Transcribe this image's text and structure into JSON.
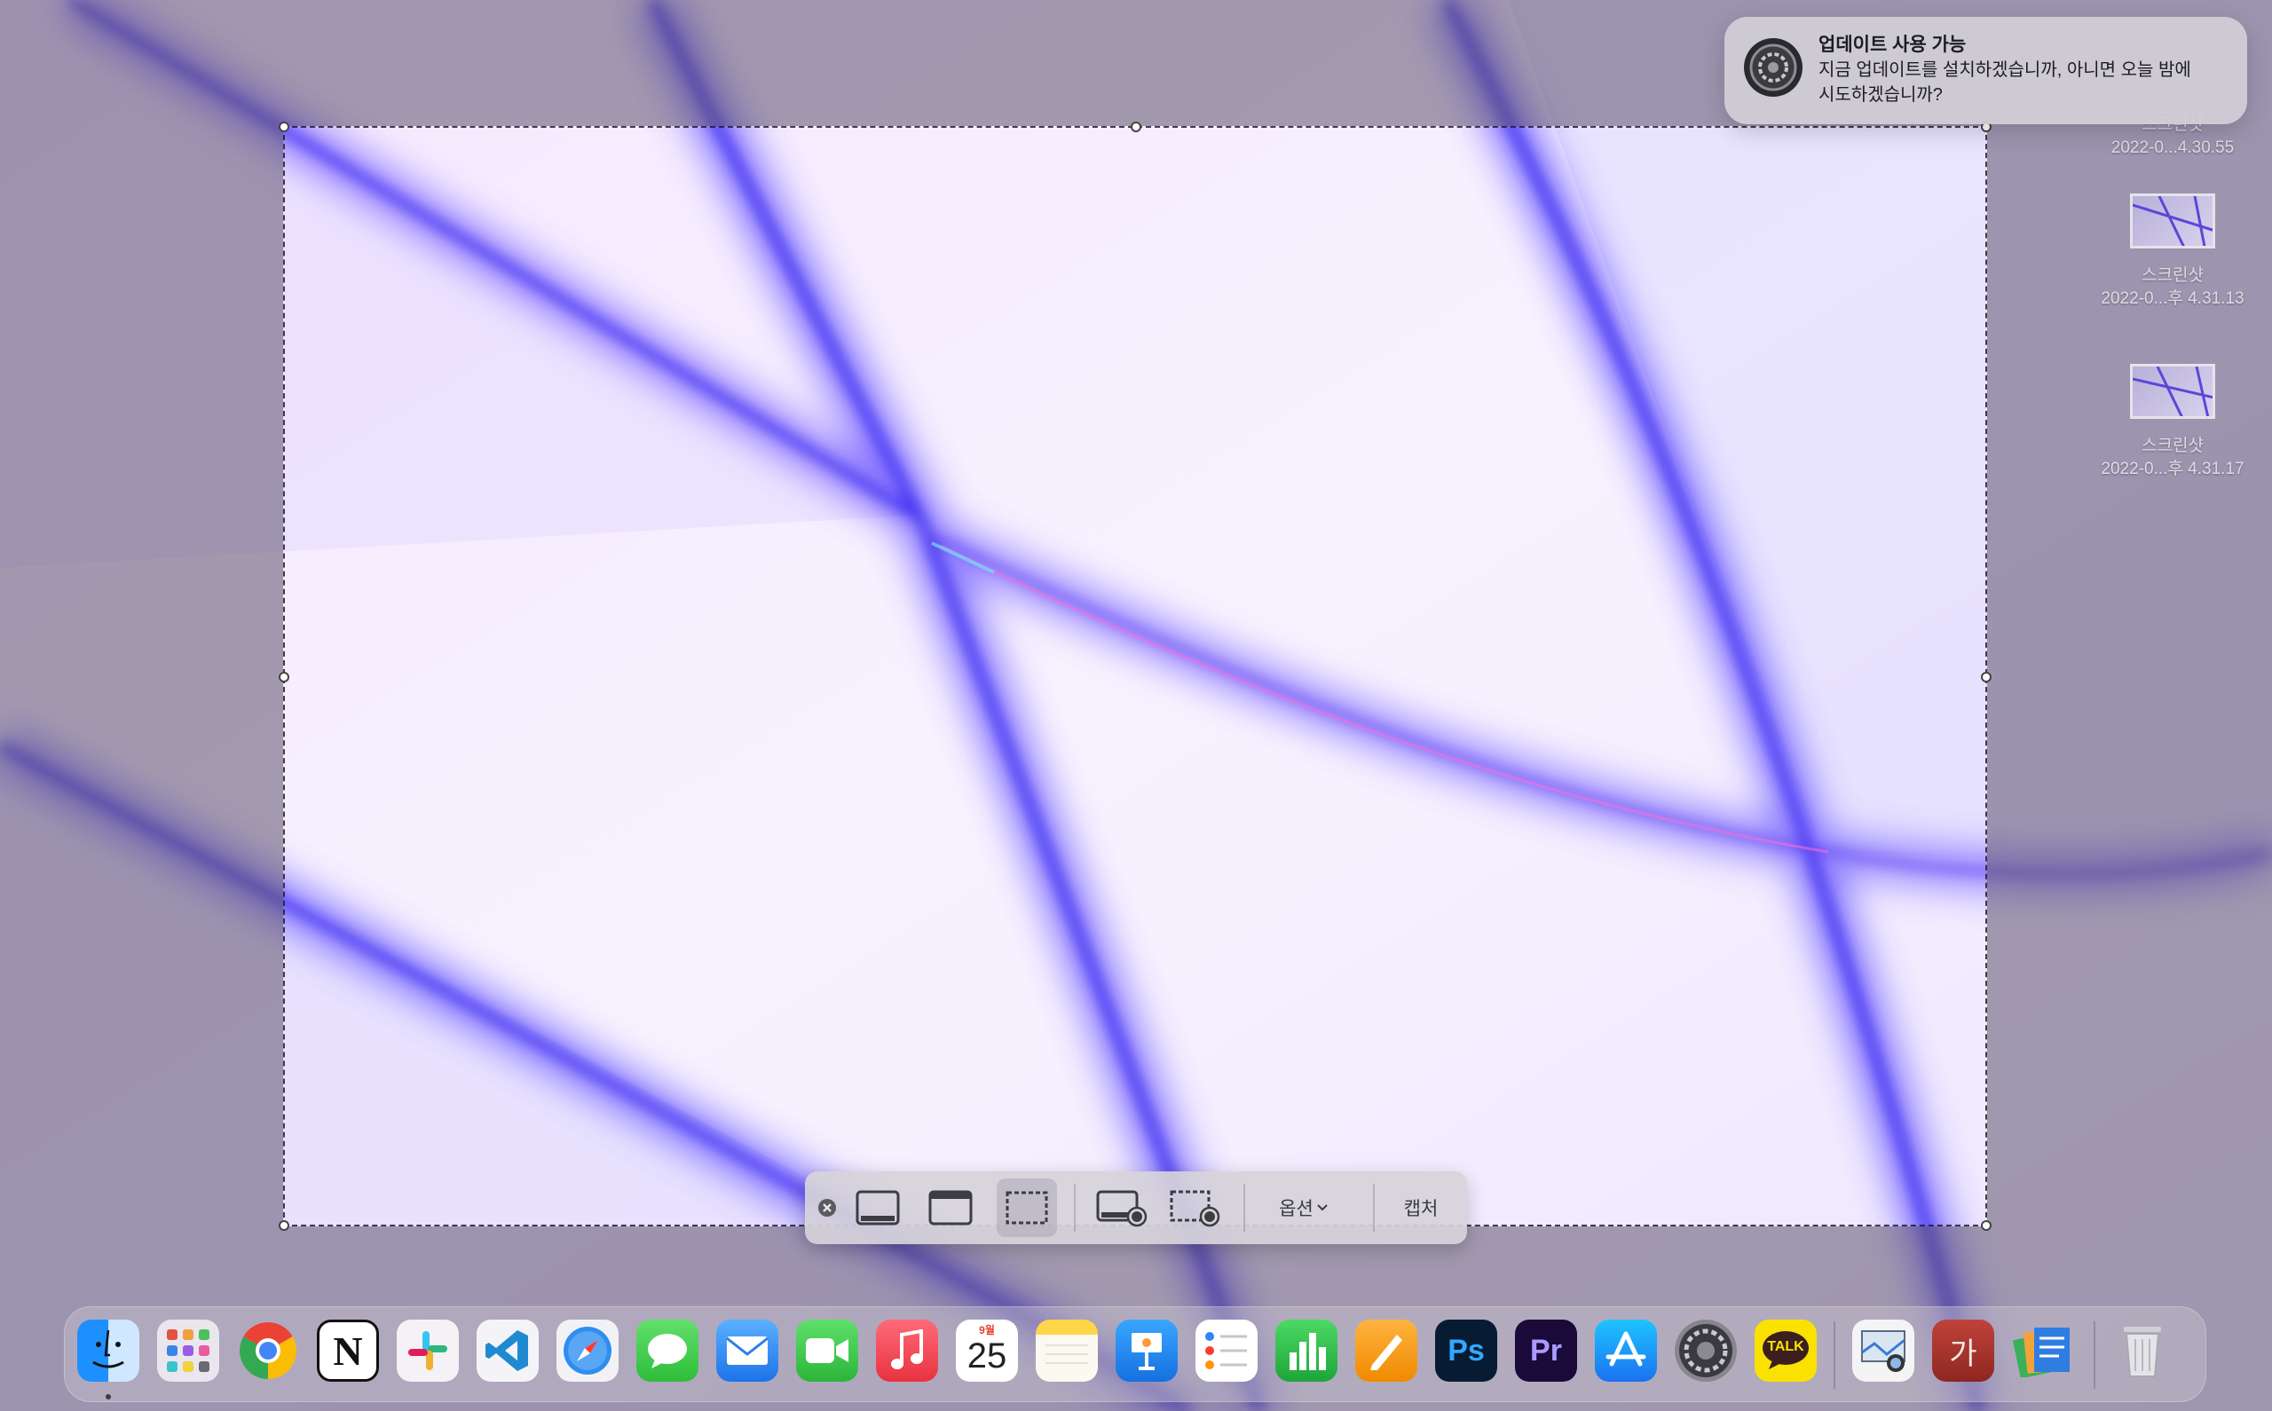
{
  "notification": {
    "title": "업데이트 사용 가능",
    "body": "지금 업데이트를 설치하겠습니까, 아니면 오늘 밤에 시도하겠습니까?",
    "icon": "system-preferences-icon"
  },
  "desktop": {
    "items": [
      {
        "name": "스크린샷",
        "date": "2022-0...4.30.55"
      },
      {
        "name": "스크린샷",
        "date": "2022-0...후 4.31.13"
      },
      {
        "name": "스크린샷",
        "date": "2022-0...후 4.31.17"
      }
    ]
  },
  "toolbar": {
    "close_icon": "close-icon",
    "options_label": "옵션",
    "capture_label": "캡처",
    "active_mode": "capture-selected-portion"
  },
  "dock": {
    "calendar_month": "9월",
    "calendar_day": "25",
    "kakaotalk_label": "TALK",
    "notion_label": "N",
    "ps_label": "Ps",
    "pr_label": "Pr",
    "dict_label": "가",
    "apps": [
      "finder-icon",
      "launchpad-icon",
      "chrome-icon",
      "notion-icon",
      "slack-icon",
      "vscode-icon",
      "safari-icon",
      "messages-icon",
      "mail-icon",
      "facetime-icon",
      "music-icon",
      "calendar-icon",
      "notes-icon",
      "keynote-icon",
      "reminders-icon",
      "numbers-icon",
      "pages-icon",
      "photoshop-icon",
      "premiere-icon",
      "app-store-icon",
      "system-preferences-icon",
      "kakaotalk-icon",
      "preview-icon",
      "dictionary-icon",
      "documents-icon",
      "trash-icon"
    ]
  },
  "colors": {
    "accent_blue": "#4a3ee0",
    "wallpaper_light": "#f4ecff"
  }
}
